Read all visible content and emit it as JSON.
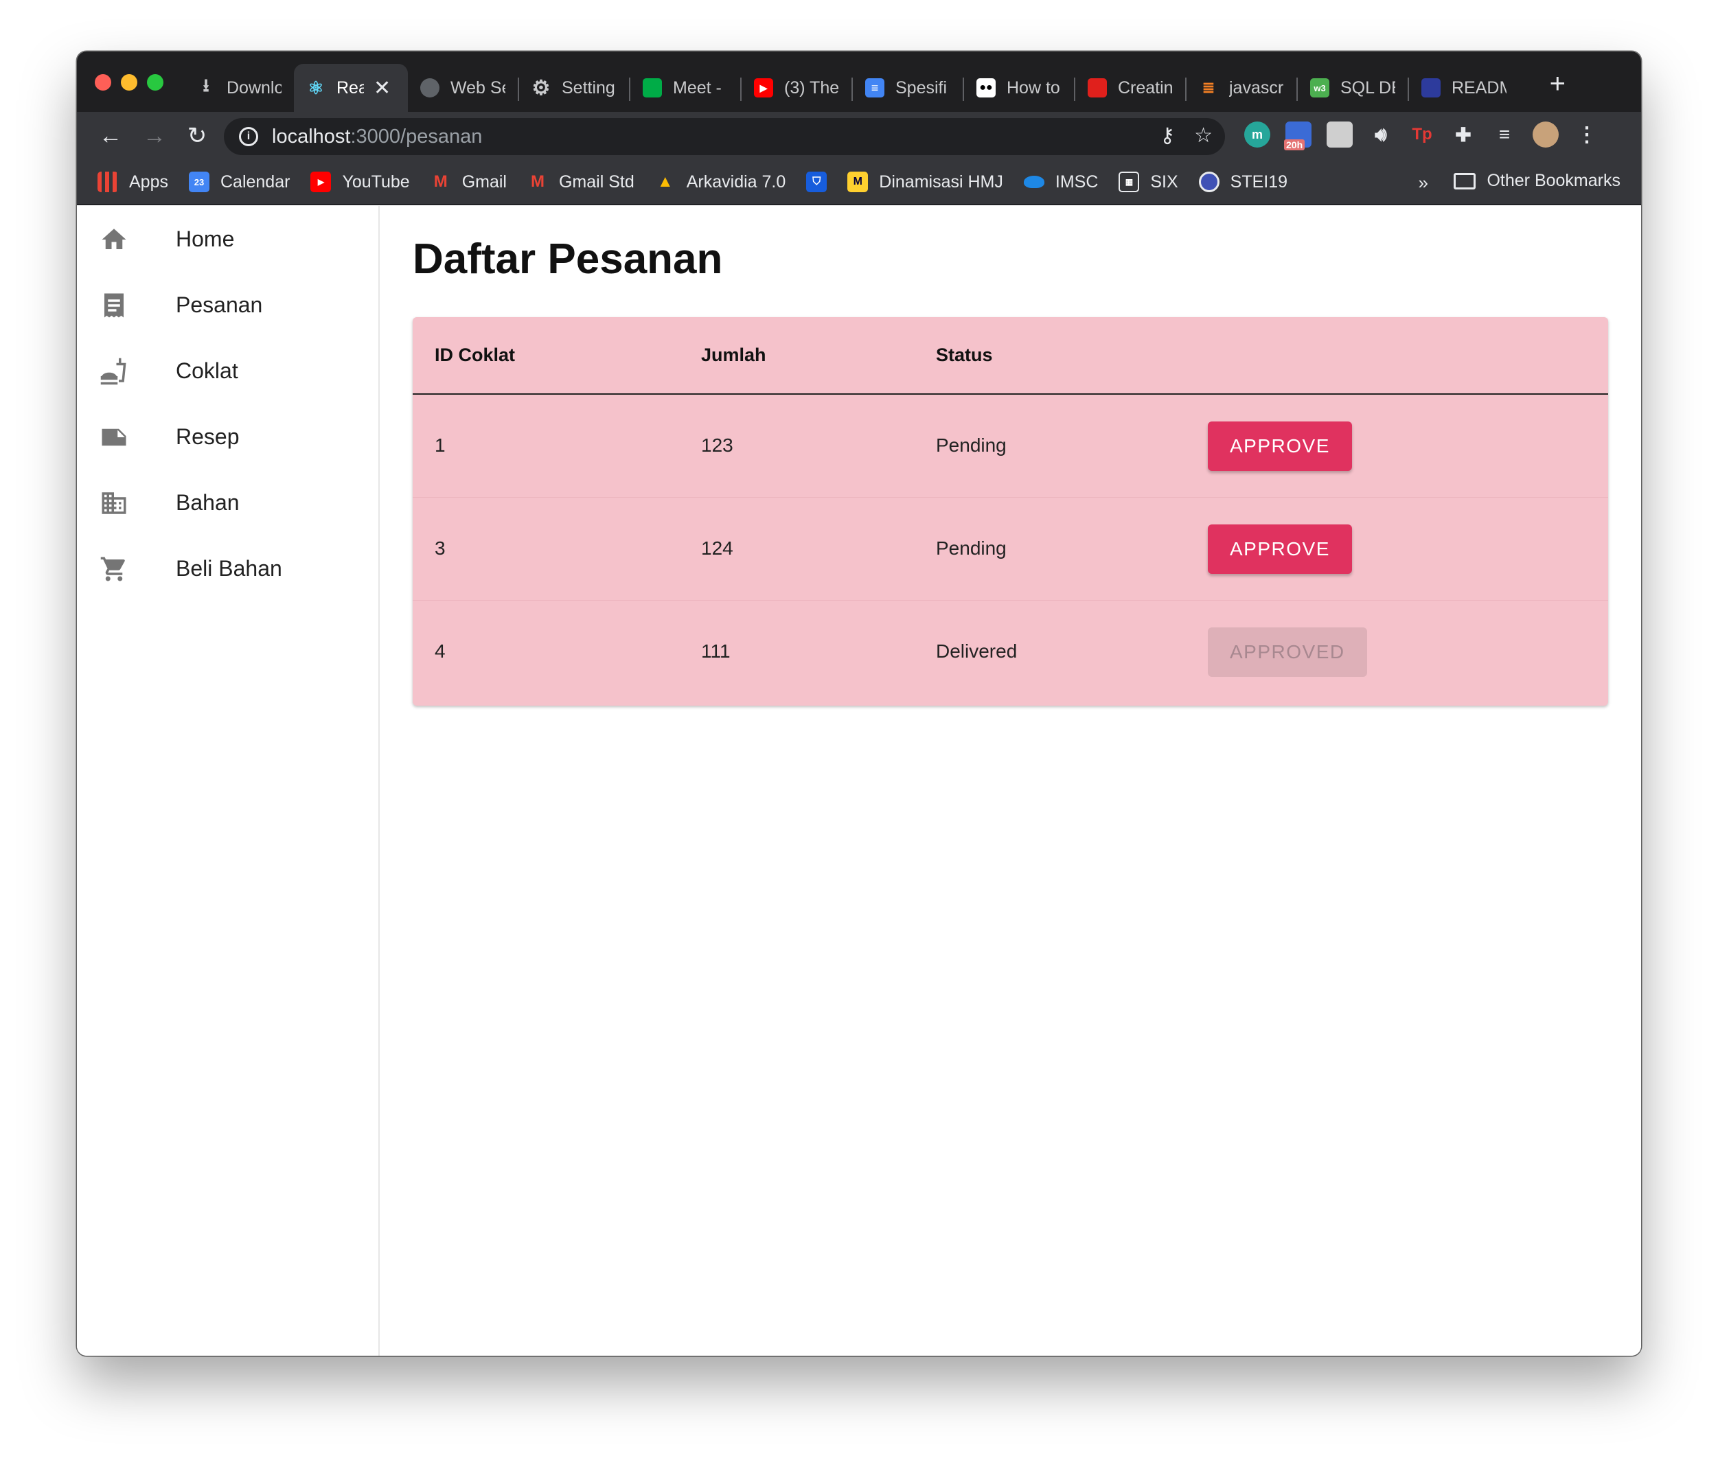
{
  "browser": {
    "tabs": [
      {
        "label": "Downlo",
        "icon": "download-icon",
        "active": false
      },
      {
        "label": "Rea",
        "icon": "react-icon",
        "active": true
      },
      {
        "label": "Web Se",
        "icon": "globe-icon",
        "active": false
      },
      {
        "label": "Setting",
        "icon": "gear-icon",
        "active": false
      },
      {
        "label": "Meet -",
        "icon": "meet-icon",
        "active": false
      },
      {
        "label": "(3) The",
        "icon": "youtube-icon",
        "active": false
      },
      {
        "label": "Spesifi",
        "icon": "docs-icon",
        "active": false
      },
      {
        "label": "How to",
        "icon": "medium-icon",
        "active": false
      },
      {
        "label": "Creatin",
        "icon": "oracle-icon",
        "active": false
      },
      {
        "label": "javascr",
        "icon": "stackoverflow-icon",
        "active": false
      },
      {
        "label": "SQL DE",
        "icon": "w3schools-icon",
        "active": false
      },
      {
        "label": "READM",
        "icon": "github-icon",
        "active": false
      }
    ],
    "url_host": "localhost",
    "url_path": ":3000/pesanan",
    "extension_badge": "20h",
    "bookmarks": [
      {
        "label": "Apps",
        "icon": "apps-grid-icon"
      },
      {
        "label": "Calendar",
        "icon": "calendar-icon"
      },
      {
        "label": "YouTube",
        "icon": "youtube-icon"
      },
      {
        "label": "Gmail",
        "icon": "gmail-icon"
      },
      {
        "label": "Gmail Std",
        "icon": "gmail-icon"
      },
      {
        "label": "Arkavidia 7.0",
        "icon": "drive-icon"
      },
      {
        "label": "",
        "icon": "bitwarden-icon"
      },
      {
        "label": "Dinamisasi HMJ",
        "icon": "miro-icon"
      },
      {
        "label": "IMSC",
        "icon": "onedrive-icon"
      },
      {
        "label": "SIX",
        "icon": "six-icon"
      },
      {
        "label": "STEI19",
        "icon": "stei-icon"
      }
    ],
    "bookmarks_more": "»",
    "other_bookmarks": "Other Bookmarks"
  },
  "sidebar": {
    "items": [
      {
        "label": "Home",
        "icon": "home-icon"
      },
      {
        "label": "Pesanan",
        "icon": "receipt-icon"
      },
      {
        "label": "Coklat",
        "icon": "fastfood-icon"
      },
      {
        "label": "Resep",
        "icon": "note-icon"
      },
      {
        "label": "Bahan",
        "icon": "building-icon"
      },
      {
        "label": "Beli Bahan",
        "icon": "cart-icon"
      }
    ]
  },
  "main": {
    "title": "Daftar Pesanan",
    "table": {
      "columns": [
        "ID Coklat",
        "Jumlah",
        "Status",
        ""
      ],
      "rows": [
        {
          "id": "1",
          "jumlah": "123",
          "status": "Pending",
          "action": "APPROVE",
          "disabled": false
        },
        {
          "id": "3",
          "jumlah": "124",
          "status": "Pending",
          "action": "APPROVE",
          "disabled": false
        },
        {
          "id": "4",
          "jumlah": "111",
          "status": "Delivered",
          "action": "APPROVED",
          "disabled": true
        }
      ]
    }
  },
  "colors": {
    "accent": "#e0325f",
    "table_bg": "#f5c2cb",
    "chrome_dark": "#35363a"
  }
}
